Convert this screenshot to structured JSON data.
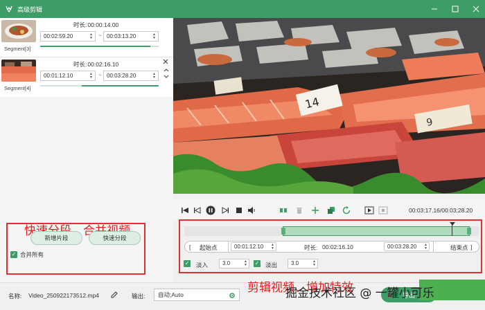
{
  "window": {
    "title": "高级剪辑"
  },
  "segments": [
    {
      "label": "Segment[3]",
      "duration_label": "时长:",
      "duration": "00:00:14.00",
      "start": "00:02:59.20",
      "end": "00:03:13.20",
      "progress_start": 0.0,
      "progress_end": 0.93
    },
    {
      "label": "Segment[4]",
      "duration_label": "时长:",
      "duration": "00:02:16.10",
      "start": "00:01:12.10",
      "end": "00:03:28.20",
      "progress_start": 0.35,
      "progress_end": 1.0
    }
  ],
  "segment_dash": "~",
  "left_actions": {
    "add_segment": "新增片段",
    "quick_split": "快速分段",
    "merge_all": "合并所有"
  },
  "annotations": {
    "left": "快速分段、合并视频",
    "right": "剪辑视频、增加特效",
    "watermark": "掘金技术社区 @ 一罐小可乐"
  },
  "player": {
    "time_display": "00:03:17.16/00:03:28.20"
  },
  "edit": {
    "start_point": "起始点",
    "start_time": "00:01:12.10",
    "duration_label": "时长:",
    "duration": "00:02:16.10",
    "end_time": "00:03:28.20",
    "end_point": "结束点",
    "selection_start": 0.335,
    "selection_end": 0.97,
    "playhead": 0.909,
    "fade_in_label": "淡入",
    "fade_in": "3.0",
    "fade_out_label": "淡出",
    "fade_out": "3.0"
  },
  "bottom": {
    "name_label": "名称:",
    "name": "Video_250922173512.mp4",
    "output_label": "输出:",
    "output_value": "自动;Auto",
    "export": "导出"
  },
  "colors": {
    "accent": "#3e9c66",
    "annotation": "#e02020"
  }
}
